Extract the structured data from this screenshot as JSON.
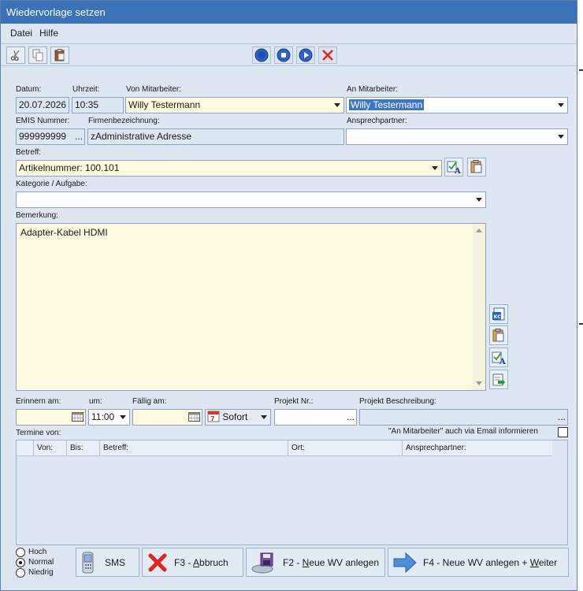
{
  "window": {
    "title": "Wiedervorlage setzen"
  },
  "menu": {
    "datei": "Datei",
    "hilfe": "Hilfe"
  },
  "form": {
    "datum_label": "Datum:",
    "datum_value": "20.07.2026",
    "uhrzeit_label": "Uhrzeit:",
    "uhrzeit_value": "10:35",
    "von_mitarbeiter_label": "Von Mitarbeiter:",
    "von_mitarbeiter_value": "Willy Testermann",
    "an_mitarbeiter_label": "An Mitarbeiter:",
    "an_mitarbeiter_value": "Willy Testermann",
    "emis_label": "EMIS Nummer:",
    "emis_value": "999999999",
    "emis_more": "...",
    "firma_label": "Firmenbezeichnung:",
    "firma_value": "zAdministrative Adresse",
    "ansprech_label": "Ansprechpartner:",
    "ansprech_value": "",
    "betreff_label": "Betreff:",
    "betreff_value": "Artikelnummer: 100.101",
    "kategorie_label": "Kategorie / Aufgabe:",
    "kategorie_value": "",
    "bemerkung_label": "Bemerkung:",
    "bemerkung_value": "Adapter-Kabel HDMI",
    "erinnern_label": "Erinnern am:",
    "erinnern_value": "",
    "um_label": "um:",
    "um_value": "11:00",
    "faellig_label": "Fällig am:",
    "faellig_value": "",
    "sofort_label": "Sofort",
    "projekt_nr_label": "Projekt Nr.:",
    "projekt_nr_value": "",
    "projekt_nr_more": "...",
    "projekt_beschr_label": "Projekt Beschreibung:",
    "projekt_beschr_value": "",
    "projekt_beschr_more": "...",
    "termine_label": "Termine von:",
    "email_info_label": "\"An Mitarbeiter\" auch via Email informieren"
  },
  "grid": {
    "columns": [
      "Von:",
      "Bis:",
      "Betreff:",
      "Ort:",
      "Ansprechpartner:"
    ]
  },
  "priority": {
    "hoch": "Hoch",
    "normal": "Normal",
    "niedrig": "Niedrig",
    "selected": "Normal"
  },
  "buttons": {
    "sms": "SMS",
    "abbruch_pre": "F3 - ",
    "abbruch_key": "A",
    "abbruch_post": "bbruch",
    "neu_pre": "F2 - ",
    "neu_key": "N",
    "neu_post": "eue WV anlegen",
    "weiter_pre": "F4 - Neue WV anlegen + ",
    "weiter_key": "W",
    "weiter_post": "eiter"
  },
  "icons": {
    "toolbar": [
      "scissors-icon",
      "copy-icon",
      "paste-icon",
      "record-icon",
      "stop-icon",
      "play-icon",
      "delete-icon"
    ],
    "side": [
      "kc-icon",
      "clipboard-icon",
      "check-text-icon",
      "export-icon"
    ]
  },
  "colors": {
    "title_bar": "#3b73b9",
    "window_bg": "#dde6f1",
    "input_yellow": "#fefbe0",
    "selection": "#3c78c9"
  }
}
